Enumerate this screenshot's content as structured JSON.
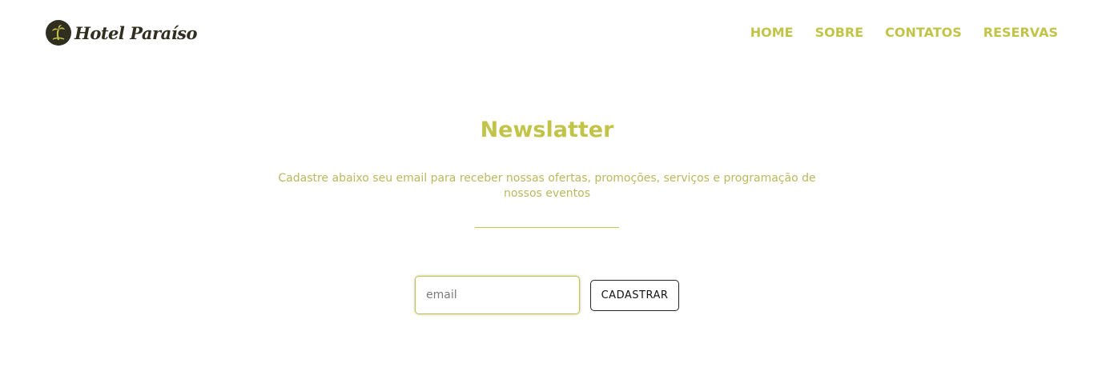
{
  "header": {
    "logo_text": "Hotel Paraíso",
    "logo_icon": "palm-tree-icon",
    "nav": [
      {
        "label": "HOME"
      },
      {
        "label": "SOBRE"
      },
      {
        "label": "CONTATOS"
      },
      {
        "label": "RESERVAS"
      }
    ]
  },
  "newsletter": {
    "title": "Newslatter",
    "description": "Cadastre abaixo seu email para receber nossas ofertas, promoções, serviços e programação de nossos eventos",
    "email_placeholder": "email",
    "submit_label": "CADASTRAR"
  },
  "colors": {
    "accent": "#c2c44a",
    "text_muted": "#b9b85e",
    "logo_dark": "#2f2e1f",
    "background": "#ffffff"
  }
}
